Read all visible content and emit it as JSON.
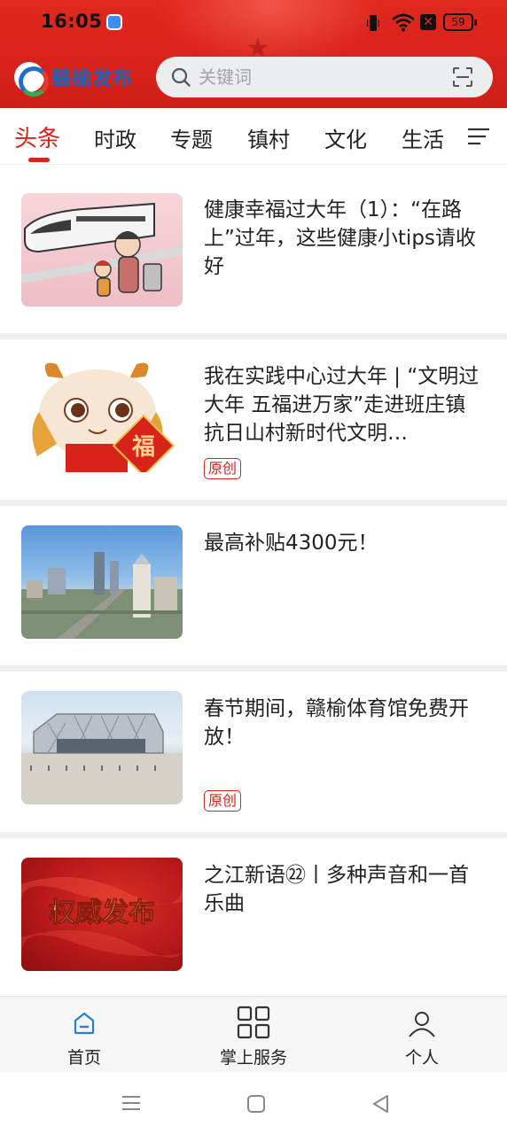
{
  "status_bar": {
    "time": "16:05",
    "battery": "59",
    "icons": [
      "app-notification-icon",
      "vibrate-icon",
      "wifi-icon",
      "sim-error-icon",
      "battery-icon"
    ]
  },
  "brand": {
    "name": "赣榆发布",
    "logo_icon": "ganyu-logo-icon"
  },
  "search": {
    "placeholder": "关键词",
    "icons": [
      "search-icon",
      "scan-icon"
    ]
  },
  "tabs": [
    {
      "label": "头条",
      "active": true
    },
    {
      "label": "时政",
      "active": false
    },
    {
      "label": "专题",
      "active": false
    },
    {
      "label": "镇村",
      "active": false
    },
    {
      "label": "文化",
      "active": false
    },
    {
      "label": "生活",
      "active": false
    }
  ],
  "articles": [
    {
      "title": "健康幸福过大年（1）：“在路上”过年，这些健康小tips请收好",
      "badge": null,
      "thumbnail": "cartoon-train-family"
    },
    {
      "title": "我在实践中心过大年 | “文明过大年 五福进万家”走进班庄镇抗日山村新时代文明…",
      "badge": "原创",
      "thumbnail": "cartoon-dragon-fu"
    },
    {
      "title": "最高补贴4300元！",
      "badge": null,
      "thumbnail": "city-skyline"
    },
    {
      "title": "春节期间，赣榆体育馆免费开放！",
      "badge": "原创",
      "thumbnail": "gymnasium"
    },
    {
      "title": "之江新语㉒丨多种声音和一首乐曲",
      "badge": null,
      "thumbnail": "authority-release-banner",
      "thumbnail_text": "权威发布"
    }
  ],
  "bottom_nav": [
    {
      "label": "首页",
      "icon": "home-icon",
      "active": true
    },
    {
      "label": "掌上服务",
      "icon": "grid-services-icon",
      "active": false
    },
    {
      "label": "个人",
      "icon": "person-icon",
      "active": false
    }
  ],
  "colors": {
    "brand_red": "#d8231b",
    "brand_blue": "#1c62b8",
    "active_tab": "#d8231b",
    "nav_active": "#2a7dd1"
  }
}
